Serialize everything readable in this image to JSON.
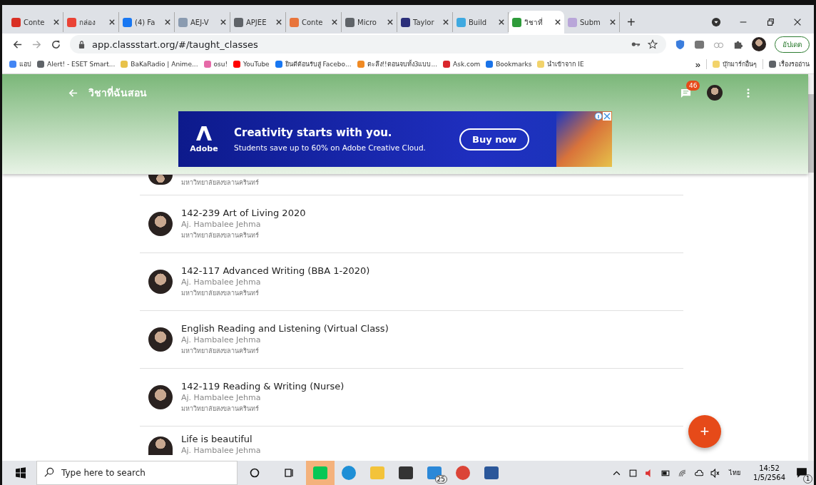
{
  "tabs": [
    {
      "title": "Conte",
      "color": "#d93025",
      "selected": false
    },
    {
      "title": "กล่อง",
      "color": "#ea4335",
      "selected": false
    },
    {
      "title": "(4) Fa",
      "color": "#1877f2",
      "selected": false
    },
    {
      "title": "AEJ-V",
      "color": "#8a9bb0",
      "selected": false
    },
    {
      "title": "APJEE",
      "color": "#5f6368",
      "selected": false
    },
    {
      "title": "Conte",
      "color": "#e8743b",
      "selected": false
    },
    {
      "title": "Micro",
      "color": "#5f6368",
      "selected": false
    },
    {
      "title": "Taylor",
      "color": "#2b2f7a",
      "selected": false
    },
    {
      "title": "Build",
      "color": "#3fa9e0",
      "selected": false
    },
    {
      "title": "วิชาที่",
      "color": "#2e9b3a",
      "selected": true
    },
    {
      "title": "Subm",
      "color": "#b9a6d9",
      "selected": false
    }
  ],
  "new_tab": "+",
  "address": "app.classstart.org/#/taught_classes",
  "update_button": "อัปเดต",
  "bookmarks": [
    {
      "label": "แอป",
      "color": "#4285f4"
    },
    {
      "label": "Alert! - ESET Smart...",
      "color": "#5f6368"
    },
    {
      "label": "BaKaRadio | Anime...",
      "color": "#e8c24a"
    },
    {
      "label": "osu!",
      "color": "#e66aa8"
    },
    {
      "label": "YouTube",
      "color": "#ff0000"
    },
    {
      "label": "ยินดีต้อนรับสู่ Facebo...",
      "color": "#1877f2"
    },
    {
      "label": "ตะลึง!!ตอนจบทั้ง3แบบ...",
      "color": "#f08a24"
    },
    {
      "label": "Ask.com",
      "color": "#d9262c"
    },
    {
      "label": "Bookmarks",
      "color": "#1a73e8"
    },
    {
      "label": "นำเข้าจาก IE",
      "color": "#f2d36b"
    }
  ],
  "bookmarks_more": "»",
  "bookmarks_right": [
    {
      "label": "บุ๊กมาร์กอื่นๆ",
      "color": "#f2d36b"
    },
    {
      "label": "เรื่องรออ่าน",
      "color": "#5f6368"
    }
  ],
  "header": {
    "title": "วิชาที่ฉันสอน",
    "badge": "46"
  },
  "ad": {
    "brand": "Adobe",
    "headline": "Creativity starts with you.",
    "subline": "Students save up to 60% on Adobe Creative Cloud.",
    "button": "Buy now"
  },
  "classes": [
    {
      "kind": "partial",
      "university": "มหาวิทยาลัยสงขลานครินทร์"
    },
    {
      "kind": "full",
      "name": "142-239 Art of Living 2020",
      "teacher": "Aj. Hambalee Jehma",
      "university": "มหาวิทยาลัยสงขลานครินทร์"
    },
    {
      "kind": "full",
      "name": "142-117 Advanced Writing (BBA 1-2020)",
      "teacher": "Aj. Hambalee Jehma",
      "university": "มหาวิทยาลัยสงขลานครินทร์"
    },
    {
      "kind": "full",
      "name": "English Reading and Listening (Virtual Class)",
      "teacher": "Aj. Hambalee Jehma",
      "university": "มหาวิทยาลัยสงขลานครินทร์"
    },
    {
      "kind": "full",
      "name": "142-119 Reading & Writing (Nurse)",
      "teacher": "Aj. Hambalee Jehma",
      "university": "มหาวิทยาลัยสงขลานครินทร์"
    },
    {
      "kind": "cut",
      "name": "Life is beautiful",
      "teacher": "Aj. Hambalee Jehma"
    }
  ],
  "fab": "+",
  "taskbar": {
    "search_placeholder": "Type here to search",
    "mail_badge": "25",
    "language": "ไทย",
    "time": "14:52",
    "date": "1/5/2564",
    "notifications": "1"
  }
}
